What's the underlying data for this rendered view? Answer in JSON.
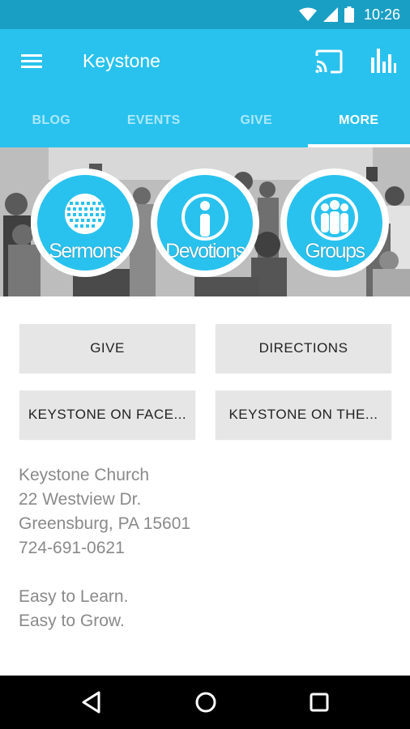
{
  "status_bar": {
    "time": "10:26",
    "icons": [
      "wifi-icon",
      "cell-signal-icon",
      "battery-icon"
    ]
  },
  "app_bar": {
    "title": "Keystone",
    "icons": [
      "menu-icon",
      "cast-icon",
      "stats-icon"
    ]
  },
  "tabs": [
    {
      "label": "BLOG",
      "active": false
    },
    {
      "label": "EVENTS",
      "active": false
    },
    {
      "label": "GIVE",
      "active": false
    },
    {
      "label": "MORE",
      "active": true
    }
  ],
  "hero": {
    "shortcuts": [
      {
        "label": "Sermons",
        "icon": "globe-icon"
      },
      {
        "label": "Devotions",
        "icon": "info-icon"
      },
      {
        "label": "Groups",
        "icon": "people-icon"
      }
    ]
  },
  "buttons": {
    "give": "GIVE",
    "directions": "DIRECTIONS",
    "facebook": "KEYSTONE ON FACE...",
    "web": "KEYSTONE ON THE..."
  },
  "info": {
    "church_name": "Keystone Church",
    "street": "22 Westview Dr.",
    "city": "Greensburg, PA 15601",
    "phone": "724-691-0621",
    "tagline_1": "Easy to Learn.",
    "tagline_2": "Easy to Grow."
  },
  "nav_bar": {
    "icons": [
      "back-icon",
      "home-icon",
      "recents-icon"
    ]
  },
  "colors": {
    "status_bar": "#1a9fc4",
    "primary": "#29c2ee",
    "button_bg": "#e6e6e6",
    "info_text": "#8a8a8a"
  }
}
